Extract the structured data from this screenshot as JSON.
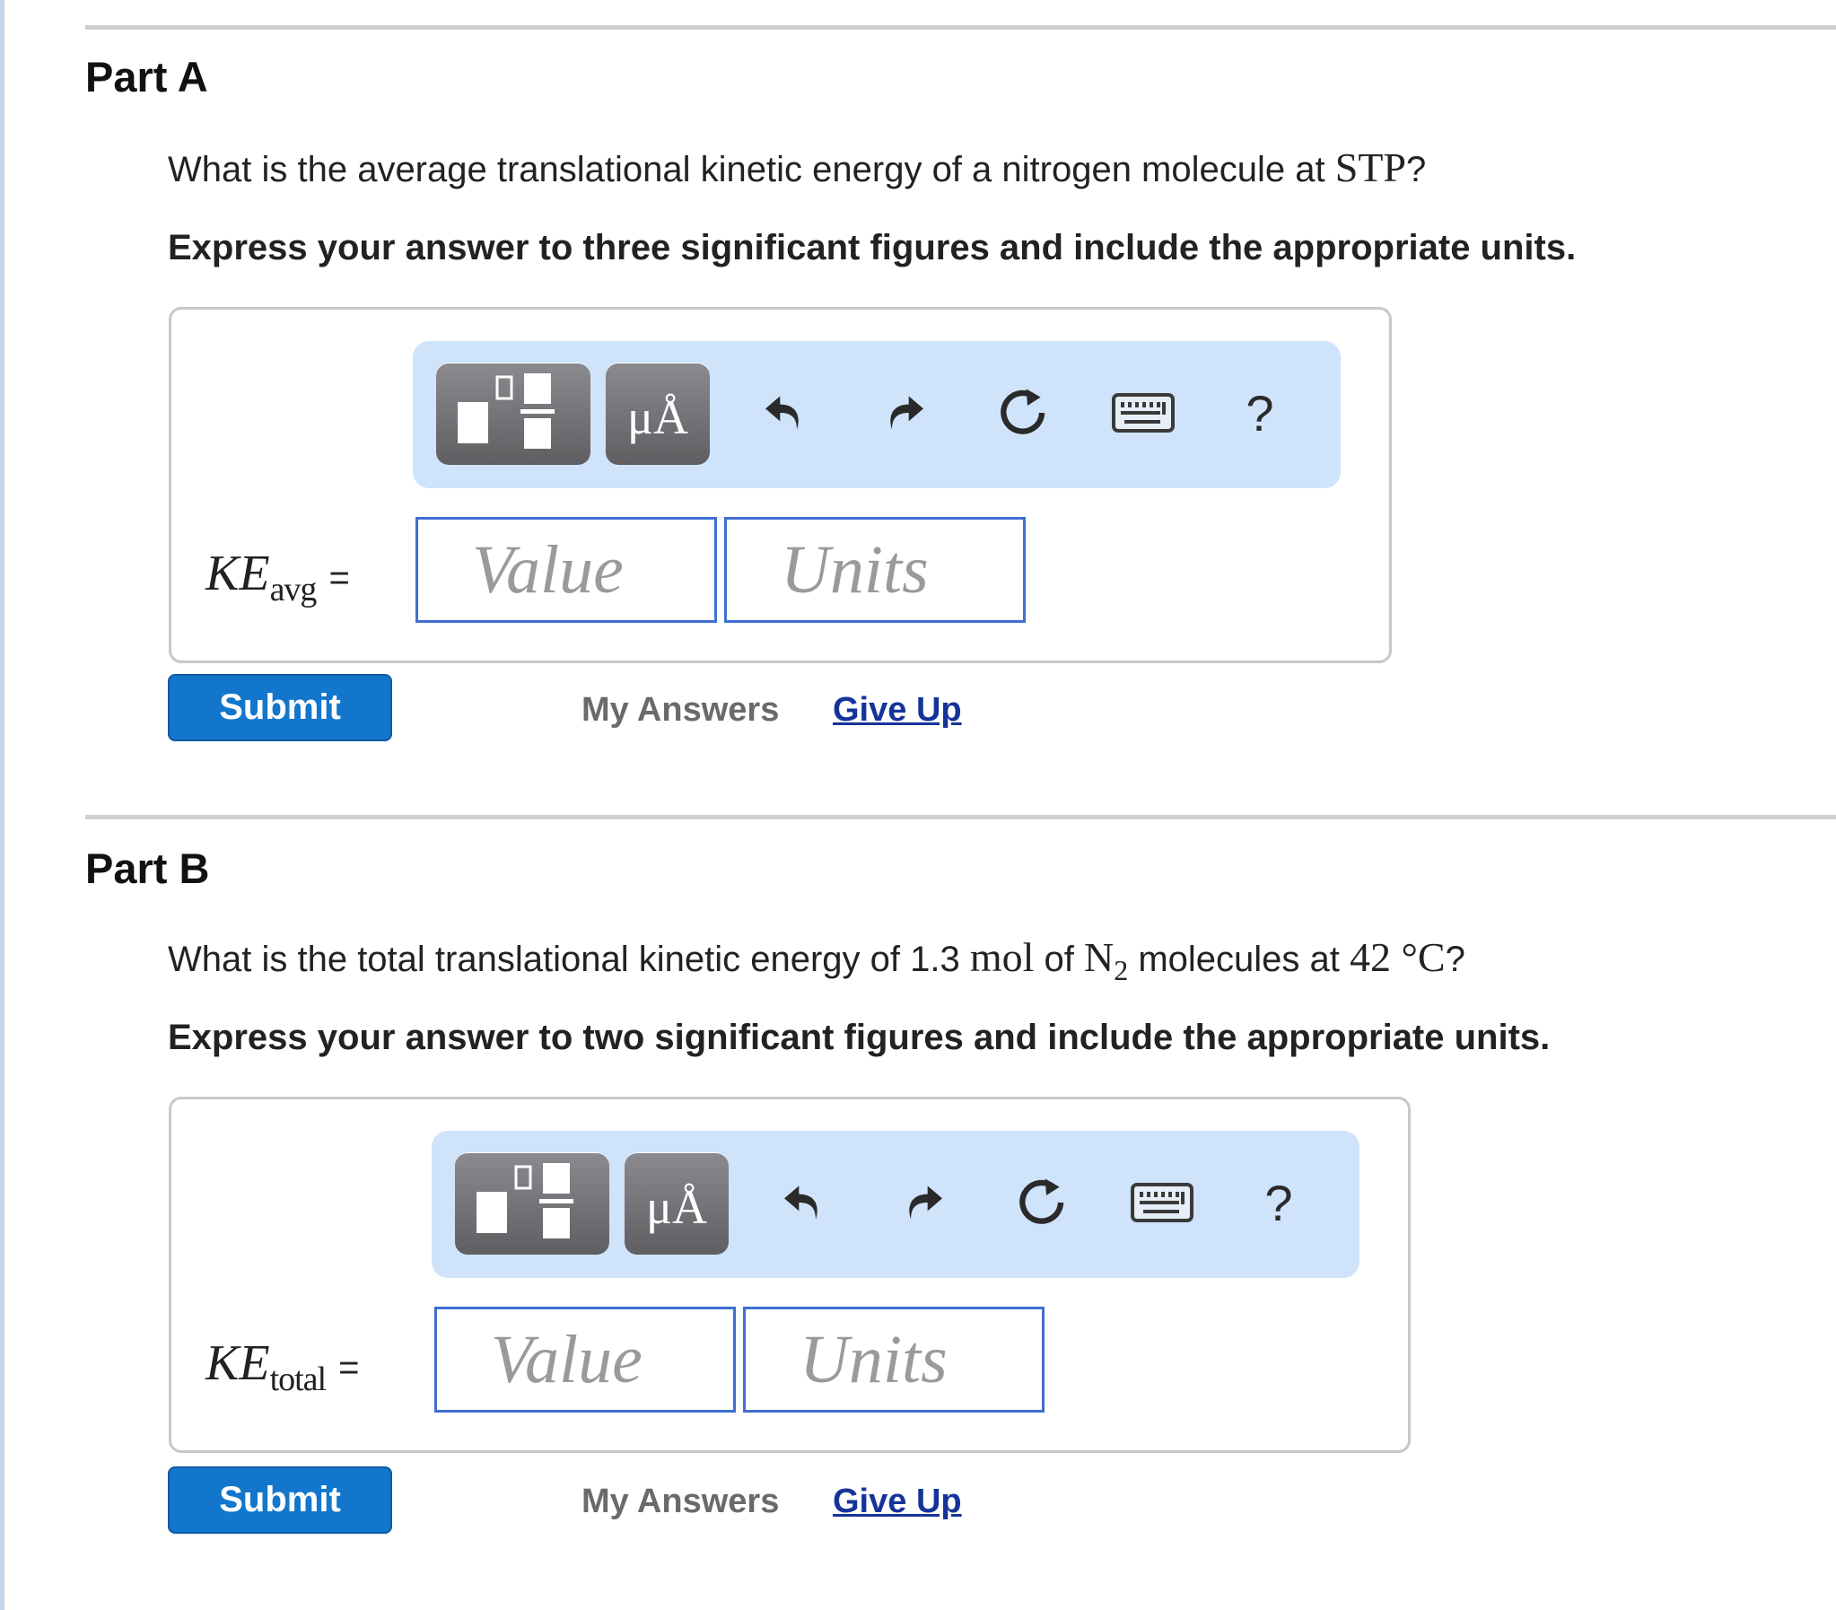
{
  "parts": [
    {
      "title": "Part A",
      "question_prefix": "What is the average translational kinetic energy of a nitrogen molecule at ",
      "question_math": "STP",
      "question_suffix": "?",
      "instruction": "Express your answer to three significant figures and include the appropriate units.",
      "variable": "KE",
      "variable_sub": "avg",
      "equals": "=",
      "value_placeholder": "Value",
      "units_placeholder": "Units",
      "submit_label": "Submit",
      "my_answers_label": "My Answers",
      "give_up_label": "Give Up"
    },
    {
      "title": "Part B",
      "question_t1": "What is the total translational kinetic energy of 1.3 ",
      "question_m1": "mol",
      "question_t2": " of ",
      "question_m2": "N",
      "question_m2_sub": "2",
      "question_t3": " molecules at ",
      "question_m3": "42 °C",
      "question_t4": "?",
      "instruction": "Express your answer to two significant figures and include the appropriate units.",
      "variable": "KE",
      "variable_sub": "total",
      "equals": "=",
      "value_placeholder": "Value",
      "units_placeholder": "Units",
      "submit_label": "Submit",
      "my_answers_label": "My Answers",
      "give_up_label": "Give Up"
    }
  ],
  "toolbar": {
    "units_button_label": "μÅ",
    "help_label": "?",
    "icons": [
      "templates-icon",
      "units-icon",
      "undo-icon",
      "redo-icon",
      "reset-icon",
      "keyboard-icon",
      "help-icon"
    ]
  }
}
